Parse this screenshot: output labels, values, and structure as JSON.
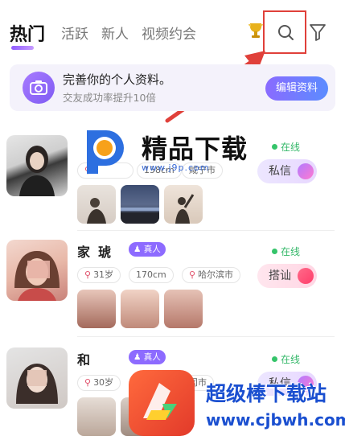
{
  "tabs": [
    {
      "label": "热门"
    },
    {
      "label": "活跃"
    },
    {
      "label": "新人"
    },
    {
      "label": "视频约会"
    }
  ],
  "icons": {
    "trophy": "trophy-icon",
    "search": "search-icon",
    "filter": "filter-icon"
  },
  "colors": {
    "accent": "#8d6bff",
    "highlight_box": "#e0403a",
    "online": "#35b86a"
  },
  "banner": {
    "title": "完善你的个人资料。",
    "subtitle": "交友成功率提升10倍",
    "button": "编辑资料"
  },
  "users": [
    {
      "status": "在线",
      "tags": [
        "",
        "158cm",
        "咸宁市"
      ],
      "action": "私信"
    },
    {
      "name": "家",
      "name_suffix": "琥",
      "verified": "真人",
      "status": "在线",
      "tags": [
        "31岁",
        "170cm",
        "哈尔滨市"
      ],
      "action": "搭讪"
    },
    {
      "name": "和",
      "verified": "真人",
      "status": "在线",
      "tags": [
        "30岁",
        "",
        "冈市"
      ],
      "action": "私信"
    }
  ],
  "watermarks": {
    "top_text": "精品下载",
    "top_url": "www.j9p.com",
    "bottom_text": "超级棒下载站",
    "bottom_url": "www.cjbwh.com"
  }
}
